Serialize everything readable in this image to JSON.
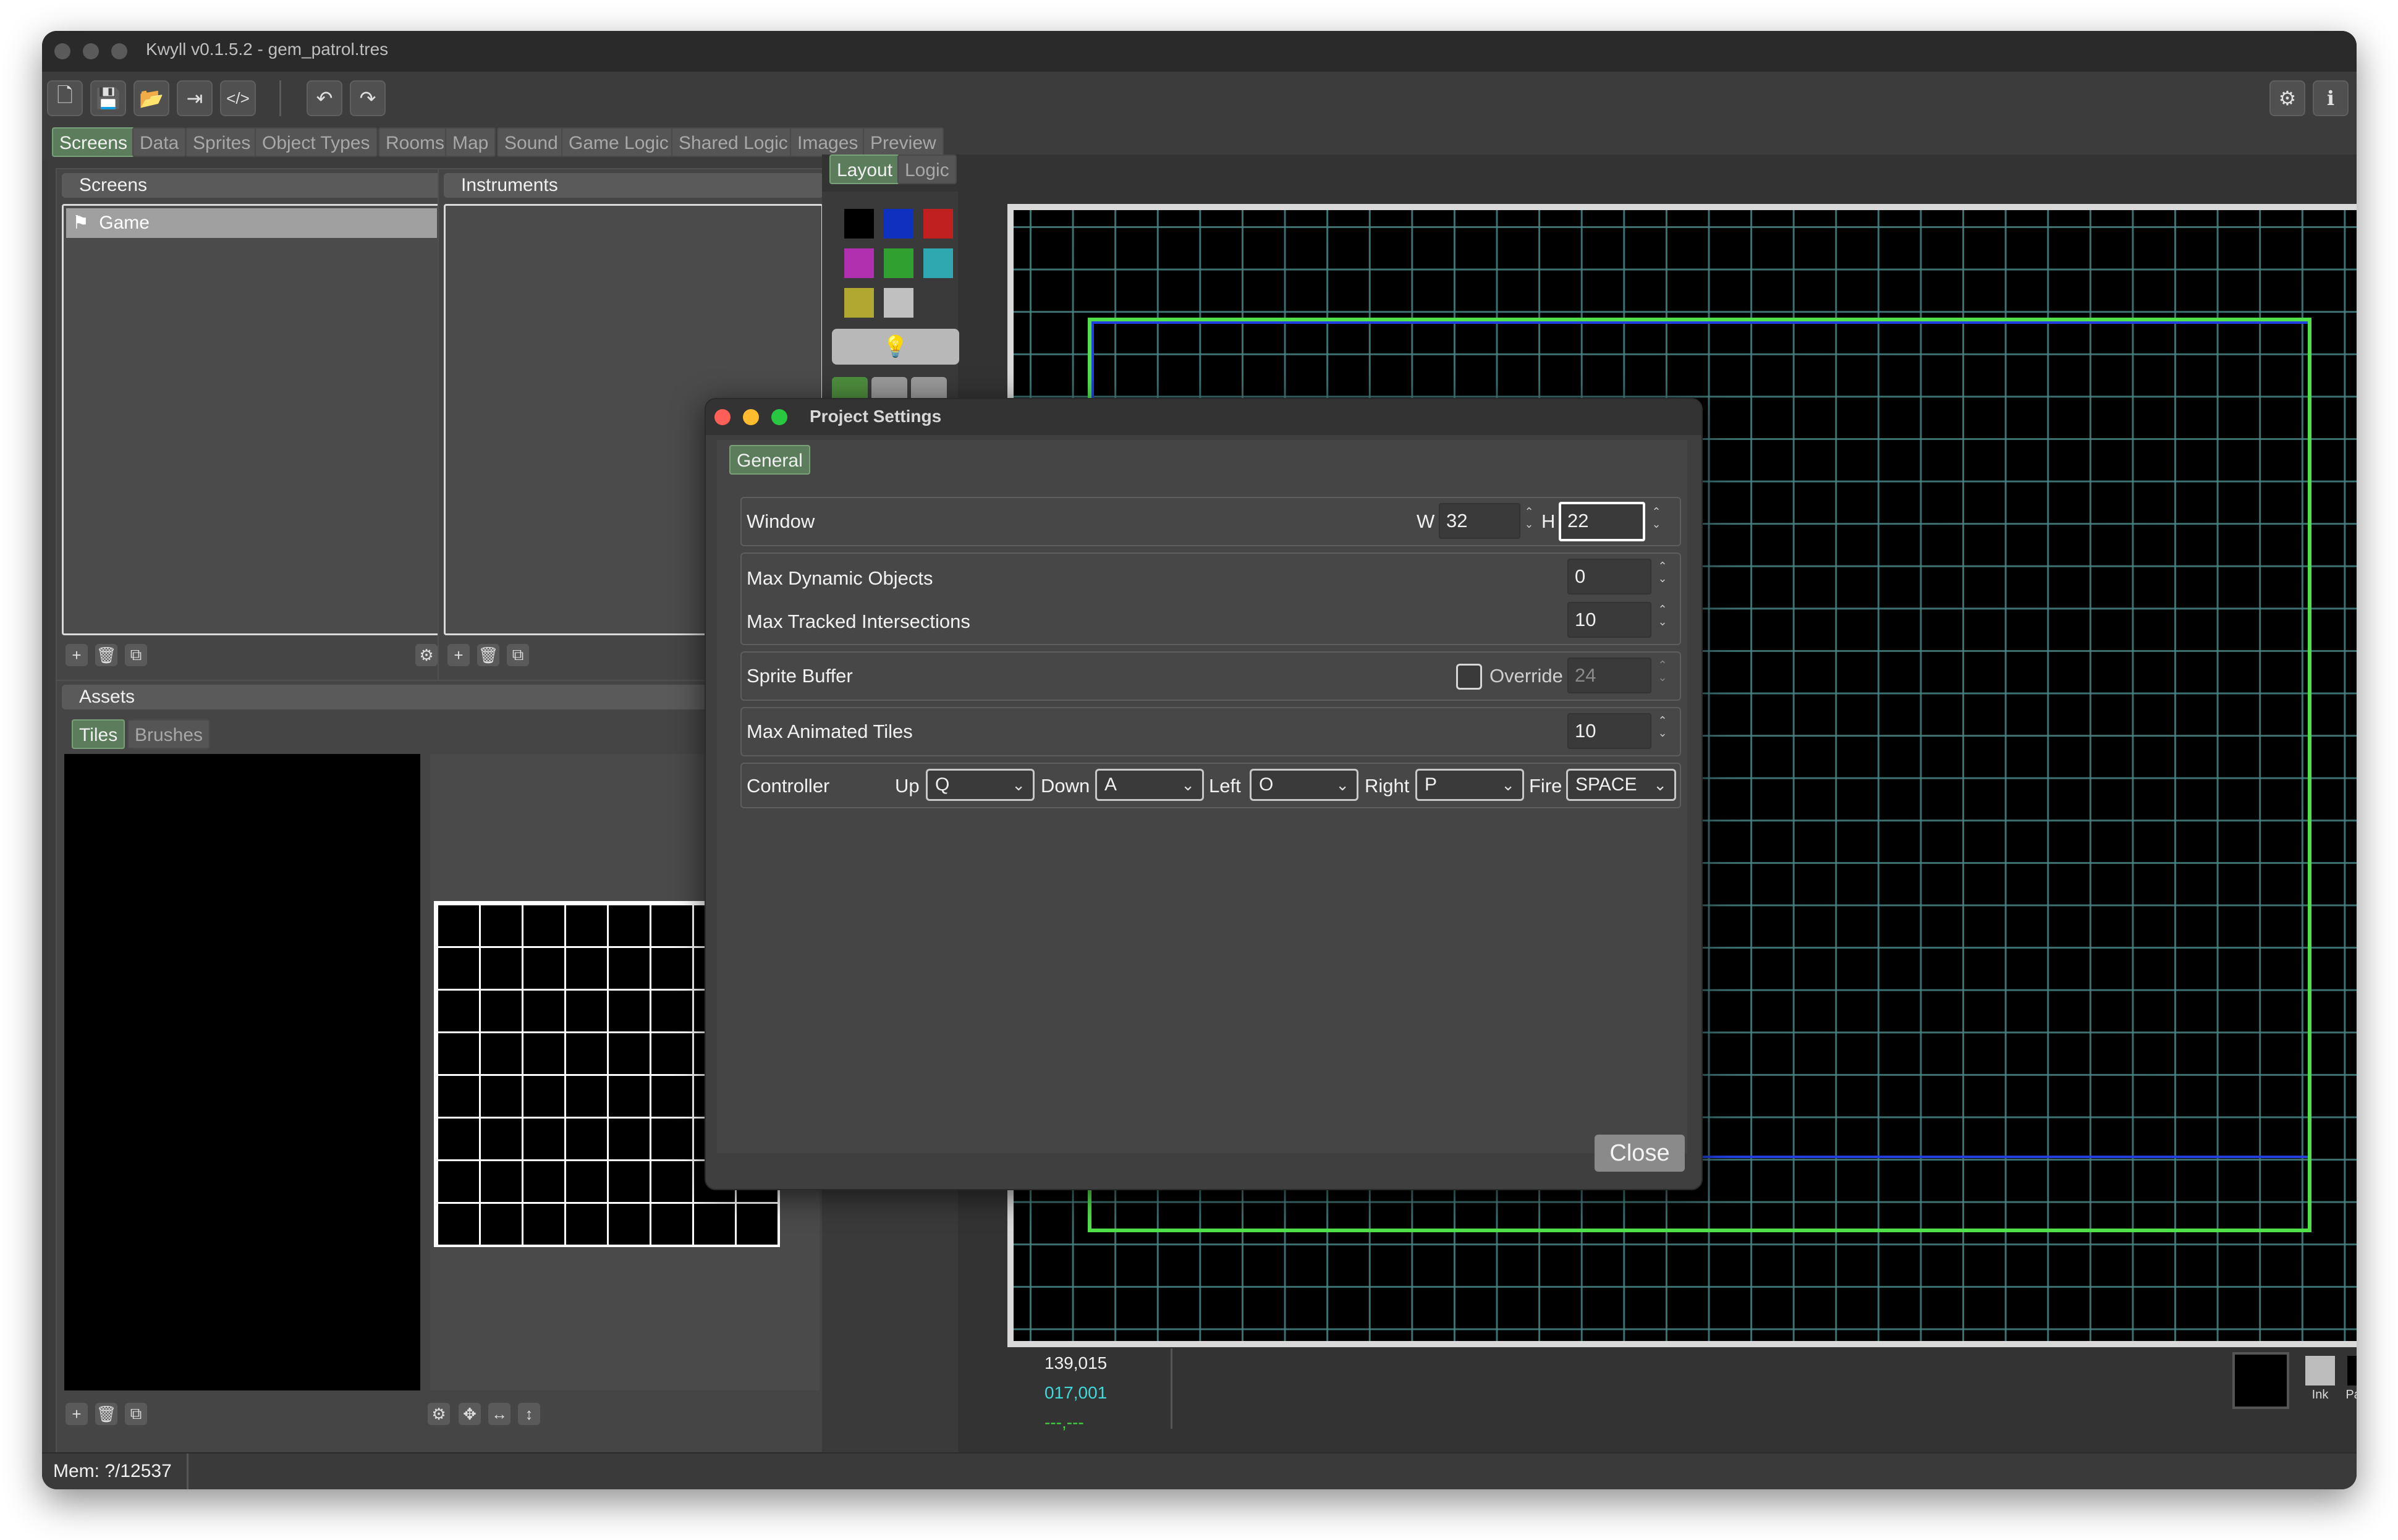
{
  "window": {
    "title": "Kwyll v0.1.5.2 - gem_patrol.tres"
  },
  "main_tabs": [
    "Screens",
    "Data",
    "Sprites",
    "Object Types",
    "Rooms",
    "Map",
    "Sound",
    "Game Logic",
    "Shared Logic",
    "Images",
    "Preview"
  ],
  "screens_panel": {
    "title": "Screens",
    "items": [
      "Game"
    ]
  },
  "instruments_panel": {
    "title": "Instruments"
  },
  "assets_panel": {
    "title": "Assets",
    "tabs": [
      "Tiles",
      "Brushes"
    ]
  },
  "editor_tabs": [
    "Layout",
    "Logic"
  ],
  "palette_colors": [
    "#000000",
    "#1030c0",
    "#c02020",
    "#b030b0",
    "#30a030",
    "#30a8b0",
    "#b0a830",
    "#c0c0c0"
  ],
  "coords": {
    "line1": "139,015",
    "line2": "017,001",
    "line3": "---,---"
  },
  "ink_paper": {
    "ink_label": "Ink",
    "paper_label": "Paper",
    "ink_color": "#bdbdbd",
    "paper_color": "#000000"
  },
  "status_bar": {
    "mem": "Mem: ?/12537"
  },
  "dialog": {
    "title": "Project Settings",
    "tab": "General",
    "window_row": {
      "label": "Window",
      "w_label": "W",
      "w_value": "32",
      "h_label": "H",
      "h_value": "22"
    },
    "max_dynamic": {
      "label": "Max Dynamic Objects",
      "value": "0"
    },
    "max_tracked": {
      "label": "Max Tracked Intersections",
      "value": "10"
    },
    "sprite_buffer": {
      "label": "Sprite Buffer",
      "override_label": "Override",
      "override_checked": false,
      "value": "24"
    },
    "max_animated": {
      "label": "Max Animated Tiles",
      "value": "10"
    },
    "controller": {
      "label": "Controller",
      "up_label": "Up",
      "up_value": "Q",
      "down_label": "Down",
      "down_value": "A",
      "left_label": "Left",
      "left_value": "O",
      "right_label": "Right",
      "right_value": "P",
      "fire_label": "Fire",
      "fire_value": "SPACE"
    },
    "close_label": "Close"
  }
}
